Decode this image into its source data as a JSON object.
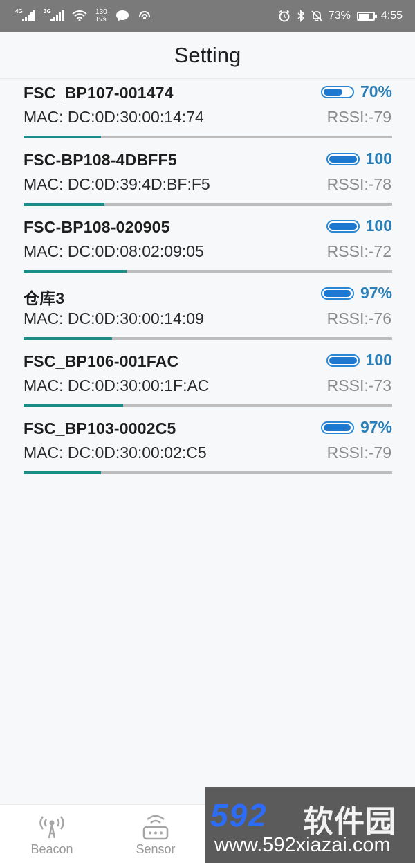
{
  "status_bar": {
    "sim1_label": "4G",
    "sim2_label": "3G",
    "net_speed_value": "130",
    "net_speed_unit": "B/s",
    "battery_percent": "73%",
    "battery_level": 0.73,
    "time": "4:55"
  },
  "header": {
    "title": "Setting"
  },
  "devices": [
    {
      "name": "FSC_BP107-001474",
      "mac": "MAC: DC:0D:30:00:14:74",
      "battery": "70%",
      "rssi": "RSSI:-79",
      "rssi_fraction": 0.21
    },
    {
      "name": "FSC-BP108-4DBFF5",
      "mac": "MAC: DC:0D:39:4D:BF:F5",
      "battery": "100",
      "rssi": "RSSI:-78",
      "rssi_fraction": 0.22
    },
    {
      "name": "FSC-BP108-020905",
      "mac": "MAC: DC:0D:08:02:09:05",
      "battery": "100",
      "rssi": "RSSI:-72",
      "rssi_fraction": 0.28
    },
    {
      "name": "仓库3",
      "mac": "MAC: DC:0D:30:00:14:09",
      "battery": "97%",
      "rssi": "RSSI:-76",
      "rssi_fraction": 0.24
    },
    {
      "name": "FSC_BP106-001FAC",
      "mac": "MAC: DC:0D:30:00:1F:AC",
      "battery": "100",
      "rssi": "RSSI:-73",
      "rssi_fraction": 0.27
    },
    {
      "name": "FSC_BP103-0002C5",
      "mac": "MAC: DC:0D:30:00:02:C5",
      "battery": "97%",
      "rssi": "RSSI:-79",
      "rssi_fraction": 0.21
    }
  ],
  "nav": {
    "beacon_label": "Beacon",
    "sensor_label": "Sensor"
  },
  "watermark": {
    "number": "592",
    "brand": "软件园",
    "url": "www.592xiazai.com"
  },
  "colors": {
    "accent_teal": "#1b8d89",
    "battery_blue": "#1d79cf",
    "percent_blue": "#2a7fb8",
    "status_bar_gray": "#7a7a7a"
  }
}
